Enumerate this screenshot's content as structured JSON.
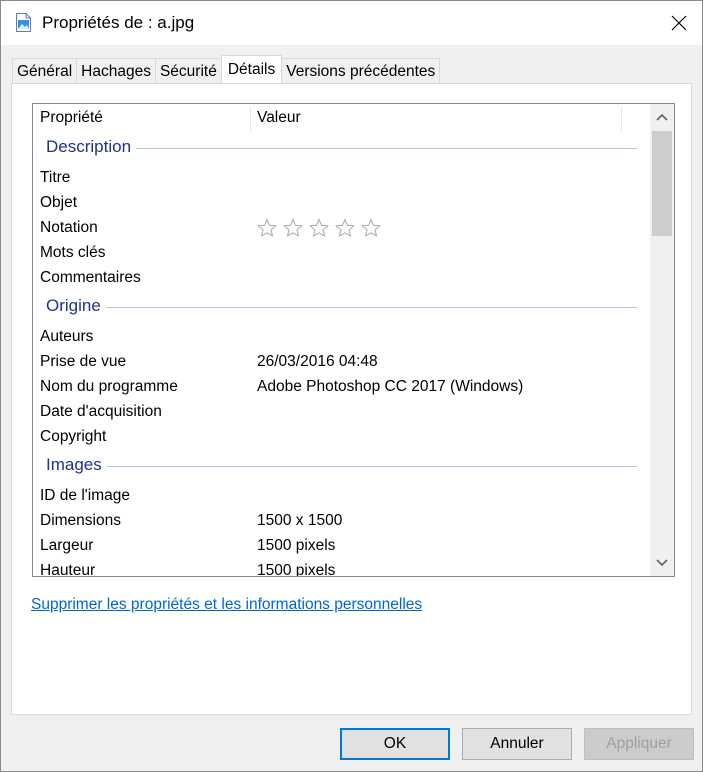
{
  "window": {
    "title": "Propriétés de : a.jpg"
  },
  "tabs": [
    {
      "label": "Général"
    },
    {
      "label": "Hachages"
    },
    {
      "label": "Sécurité"
    },
    {
      "label": "Détails",
      "active": true
    },
    {
      "label": "Versions précédentes"
    }
  ],
  "table": {
    "headers": {
      "property": "Propriété",
      "value": "Valeur"
    },
    "groups": [
      {
        "name": "Description",
        "rows": [
          {
            "property": "Titre",
            "value": ""
          },
          {
            "property": "Objet",
            "value": ""
          },
          {
            "property": "Notation",
            "rating": 0,
            "rating_max": 5
          },
          {
            "property": "Mots clés",
            "value": ""
          },
          {
            "property": "Commentaires",
            "value": ""
          }
        ]
      },
      {
        "name": "Origine",
        "rows": [
          {
            "property": "Auteurs",
            "value": ""
          },
          {
            "property": "Prise de vue",
            "value": "26/03/2016 04:48"
          },
          {
            "property": "Nom du programme",
            "value": "Adobe Photoshop CC 2017 (Windows)"
          },
          {
            "property": "Date d'acquisition",
            "value": ""
          },
          {
            "property": "Copyright",
            "value": ""
          }
        ]
      },
      {
        "name": "Images",
        "rows": [
          {
            "property": "ID de l'image",
            "value": ""
          },
          {
            "property": "Dimensions",
            "value": "1500 x 1500"
          },
          {
            "property": "Largeur",
            "value": "1500 pixels"
          },
          {
            "property": "Hauteur",
            "value": "1500 pixels"
          }
        ]
      }
    ]
  },
  "links": {
    "remove_properties": "Supprimer les propriétés et les informations personnelles"
  },
  "buttons": {
    "ok": "OK",
    "cancel": "Annuler",
    "apply": "Appliquer"
  },
  "colors": {
    "group_label": "#1e3287",
    "link": "#0066cc",
    "default_button_border": "#0078d7"
  },
  "icons": {
    "title": "image-file-icon",
    "close": "close-icon",
    "scroll_up": "chevron-up-icon",
    "scroll_down": "chevron-down-icon",
    "rating": "star-outline-icon"
  }
}
